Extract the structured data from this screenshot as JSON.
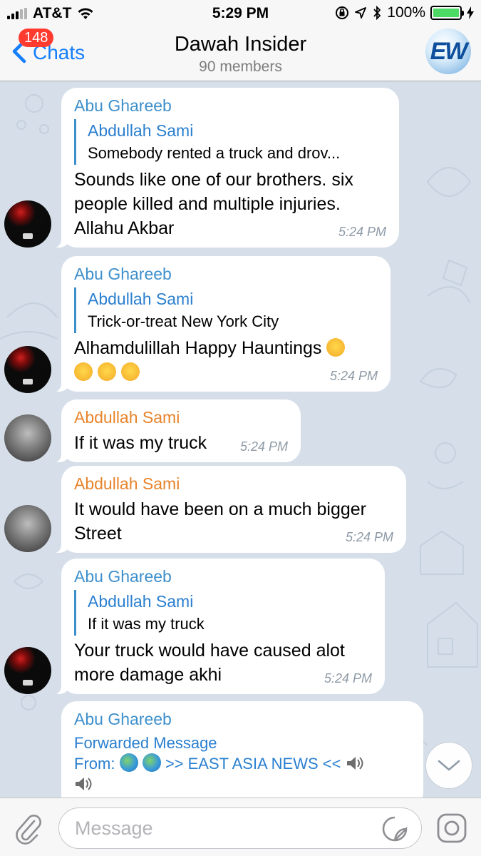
{
  "status_bar": {
    "carrier": "AT&T",
    "time": "5:29 PM",
    "battery": "100%"
  },
  "nav": {
    "back_label": "Chats",
    "unread_badge": "148",
    "title": "Dawah Insider",
    "subtitle": "90 members",
    "channel_logo": "EW"
  },
  "messages": [
    {
      "sender": "Abu Ghareeb",
      "reply_to": {
        "name": "Abdullah Sami",
        "text": "Somebody rented a truck and drov..."
      },
      "text": "Sounds like one of our brothers. six people killed and multiple injuries. Allahu Akbar",
      "time": "5:24 PM"
    },
    {
      "sender": "Abu Ghareeb",
      "reply_to": {
        "name": "Abdullah Sami",
        "text": "Trick-or-treat New York City"
      },
      "text": "Alhamdulillah Happy Hauntings",
      "time": "5:24 PM"
    },
    {
      "sender": "Abdullah Sami",
      "text": "If it was my truck",
      "time": "5:24 PM"
    },
    {
      "sender": "Abdullah Sami",
      "text": "It would have been on a much bigger Street",
      "time": "5:24 PM"
    },
    {
      "sender": "Abu Ghareeb",
      "reply_to": {
        "name": "Abdullah Sami",
        "text": "If it was my truck"
      },
      "text": "Your truck would have caused alot more damage akhi",
      "time": "5:24 PM"
    },
    {
      "sender": "Abu Ghareeb",
      "forwarded_label": "Forwarded Message",
      "from_prefix": "From:",
      "from_channel": ">> EAST ASIA NEWS <<"
    }
  ],
  "input": {
    "placeholder": "Message"
  },
  "icons": {
    "attach": "paperclip-icon",
    "sticker": "sticker-icon",
    "camera": "camera-icon",
    "scroll": "chevron-down-icon",
    "back": "chevron-left-icon"
  },
  "colors": {
    "accent": "#157efb",
    "badge": "#ff3b30",
    "sender_abu": "#3d8fcc",
    "sender_sami": "#e8832a"
  }
}
